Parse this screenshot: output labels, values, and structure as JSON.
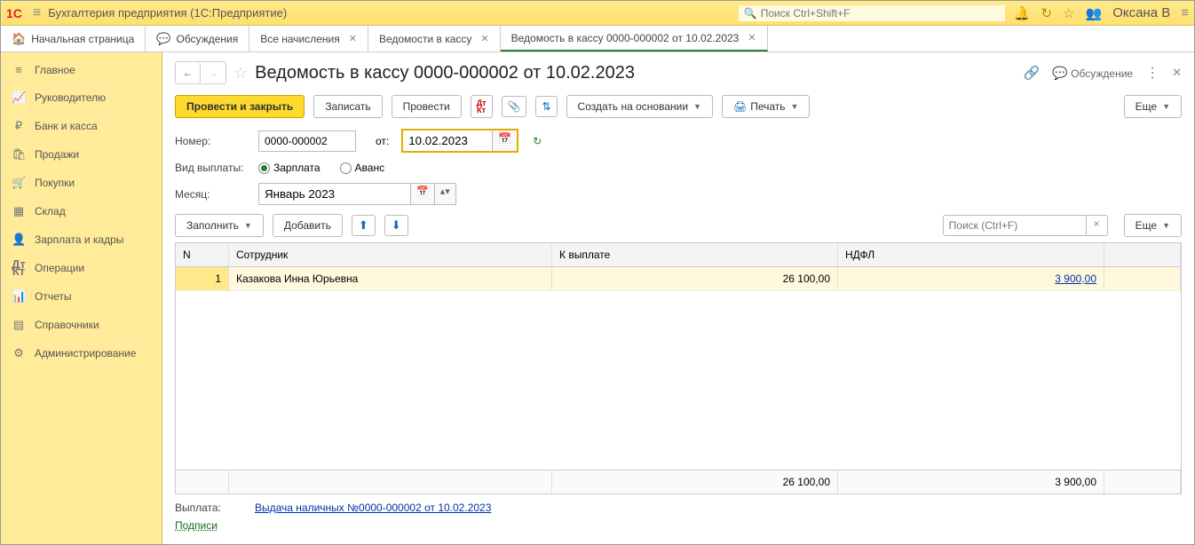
{
  "app": {
    "title": "Бухгалтерия предприятия  (1С:Предприятие)",
    "search_ph": "Поиск Ctrl+Shift+F",
    "user": "Оксана В"
  },
  "tabs": {
    "home": "Начальная страница",
    "discuss": "Обсуждения",
    "t1": "Все начисления",
    "t2": "Ведомости в кассу",
    "t3": "Ведомость в кассу 0000-000002 от 10.02.2023"
  },
  "sidebar": {
    "items": [
      "Главное",
      "Руководителю",
      "Банк и касса",
      "Продажи",
      "Покупки",
      "Склад",
      "Зарплата и кадры",
      "Операции",
      "Отчеты",
      "Справочники",
      "Администрирование"
    ]
  },
  "doc": {
    "title": "Ведомость в кассу 0000-000002 от 10.02.2023",
    "discuss_label": "Обсуждение"
  },
  "toolbar": {
    "post_close": "Провести и закрыть",
    "save": "Записать",
    "post": "Провести",
    "create_based": "Создать на основании",
    "print": "Печать",
    "more": "Еще"
  },
  "form": {
    "number_lbl": "Номер:",
    "number_val": "0000-000002",
    "from_lbl": "от:",
    "date_val": "10.02.2023",
    "paytype_lbl": "Вид выплаты:",
    "salary": "Зарплата",
    "advance": "Аванс",
    "month_lbl": "Месяц:",
    "month_val": "Январь 2023"
  },
  "grid_tb": {
    "fill": "Заполнить",
    "add": "Добавить",
    "search_ph": "Поиск (Ctrl+F)",
    "more": "Еще"
  },
  "grid": {
    "head": {
      "n": "N",
      "emp": "Сотрудник",
      "pay": "К выплате",
      "ndfl": "НДФЛ"
    },
    "rows": [
      {
        "n": "1",
        "emp": "Казакова Инна Юрьевна",
        "pay": "26 100,00",
        "ndfl": "3 900,00"
      }
    ],
    "totals": {
      "pay": "26 100,00",
      "ndfl": "3 900,00"
    }
  },
  "footer": {
    "pay_lbl": "Выплата:",
    "pay_link": "Выдача наличных №0000-000002 от 10.02.2023",
    "sign": "Подписи"
  }
}
